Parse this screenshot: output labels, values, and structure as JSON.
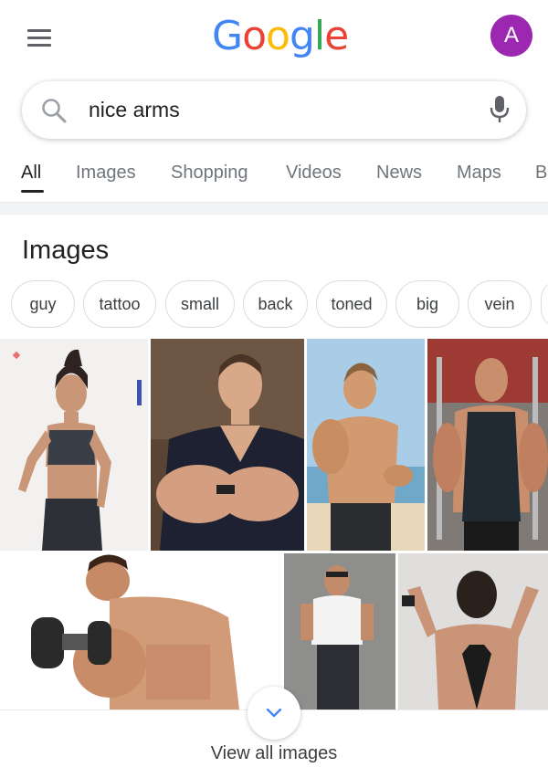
{
  "header": {
    "logo_letters": [
      "G",
      "o",
      "o",
      "g",
      "l",
      "e"
    ],
    "logo_colors": [
      "#4285f4",
      "#ea4335",
      "#fbbc05",
      "#4285f4",
      "#34a853",
      "#ea4335"
    ],
    "avatar_letter": "A",
    "avatar_color": "#9c27b0"
  },
  "search": {
    "query": "nice arms"
  },
  "tabs": [
    {
      "label": "All",
      "active": true
    },
    {
      "label": "Images"
    },
    {
      "label": "Shopping"
    },
    {
      "label": "Videos"
    },
    {
      "label": "News"
    },
    {
      "label": "Maps"
    },
    {
      "label": "B"
    }
  ],
  "images_section": {
    "title": "Images",
    "chips": [
      "guy",
      "tattoo",
      "small",
      "back",
      "toned",
      "big",
      "vein"
    ],
    "view_all_label": "View all images"
  },
  "icons": {
    "menu": "hamburger-menu-icon",
    "search": "search-icon",
    "mic": "microphone-icon",
    "expand": "chevron-down-icon"
  }
}
